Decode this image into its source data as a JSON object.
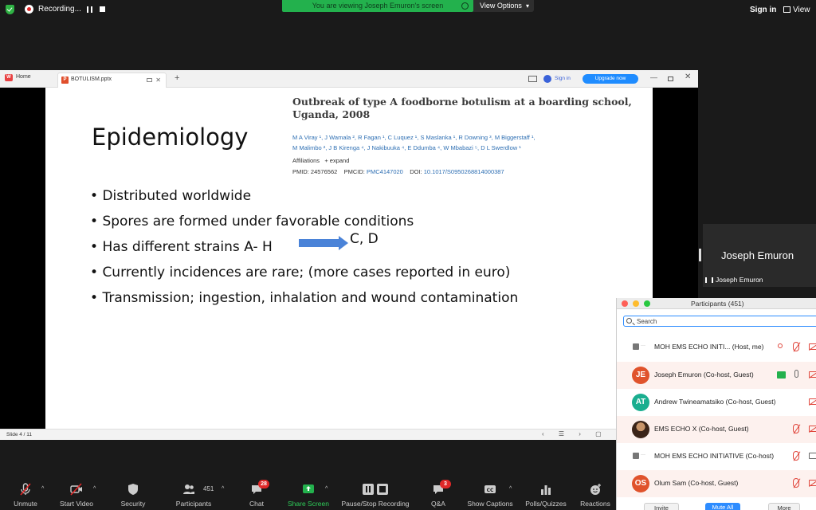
{
  "top_bar": {
    "recording_label": "Recording...",
    "viewing_banner": "You are viewing Joseph Emuron's screen",
    "view_options": "View Options",
    "sign_in": "Sign in",
    "view": "View"
  },
  "browser": {
    "home_tab": "Home",
    "file_tab": "BOTULISM.pptx",
    "sign_in": "Sign in",
    "upgrade": "Upgrade now",
    "slide_number": "Slide 4 / 11"
  },
  "slide": {
    "title": "Epidemiology",
    "paper_title": "Outbreak of type A foodborne botulism at a boarding school, Uganda, 2008",
    "authors_line1": "M A Viray ¹, J Wamala ², R Fagan ¹, C Luquez ¹, S Maslanka ¹, R Downing ³, M Biggerstaff ¹,",
    "authors_line2": "M Malimbo ², J B Kirenga ⁴, J Nakibuuka ⁴, E Ddumba ⁴, W Mbabazi ⁵, D L Swerdlow ¹",
    "affiliations": "Affiliations",
    "expand": "+ expand",
    "pmid_label": "PMID: 24576562",
    "pmcid_label": "PMCID:",
    "pmcid_value": "PMC4147020",
    "doi_label": "DOI:",
    "doi_value": "10.1017/S0950268814000387",
    "bullets": [
      "Distributed worldwide",
      "Spores are formed under favorable conditions",
      "Has different strains  A- H",
      "Currently incidences are rare; (more cases reported in euro)",
      "Transmission; ingestion, inhalation and wound contamination"
    ],
    "arrow_target": "C, D"
  },
  "speaker_tile": {
    "name_big": "Joseph Emuron",
    "name_small": "Joseph Emuron"
  },
  "participants": {
    "title": "Participants (451)",
    "search_placeholder": "Search",
    "rows": [
      {
        "initials": "",
        "name": "MOH EMS ECHO INITI... (Host, me)"
      },
      {
        "initials": "JE",
        "name": "Joseph Emuron (Co-host, Guest)"
      },
      {
        "initials": "AT",
        "name": "Andrew Twineamatsiko (Co-host, Guest)"
      },
      {
        "initials": "",
        "name": "EMS ECHO X (Co-host, Guest)"
      },
      {
        "initials": "",
        "name": "MOH EMS ECHO INITIATIVE (Co-host)"
      },
      {
        "initials": "OS",
        "name": "Olum Sam (Co-host, Guest)"
      }
    ],
    "invite": "Invite",
    "mute_all": "Mute All",
    "more": "More"
  },
  "toolbar": {
    "unmute": "Unmute",
    "start_video": "Start Video",
    "security": "Security",
    "participants": "Participants",
    "participants_count": "451",
    "chat": "Chat",
    "chat_badge": "28",
    "share_screen": "Share Screen",
    "pause_stop": "Pause/Stop Recording",
    "qa": "Q&A",
    "qa_badge": "3",
    "captions": "Show Captions",
    "polls": "Polls/Quizzes",
    "reactions": "Reactions"
  },
  "colors": {
    "zoom_green": "#23b14d",
    "zoom_blue": "#2d8cff",
    "alert_red": "#e02828",
    "arrow_blue": "#4a83d8"
  }
}
